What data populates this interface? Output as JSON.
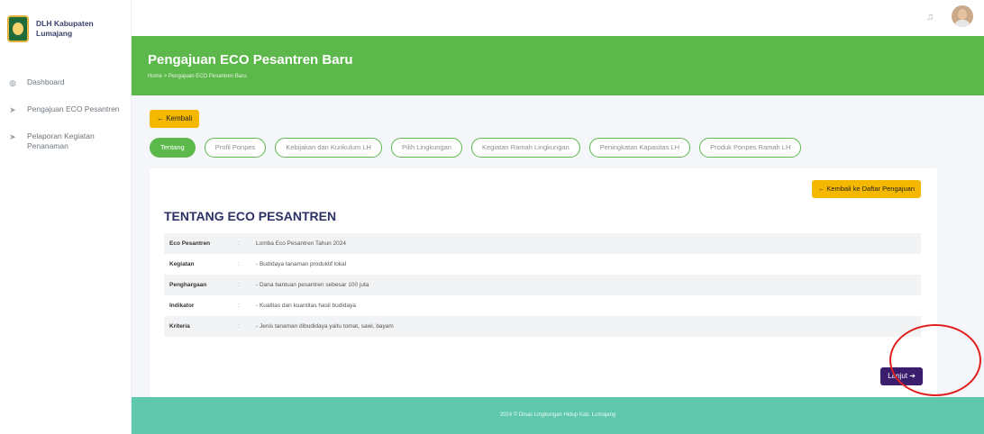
{
  "brand": {
    "line1": "DLH Kabupaten",
    "line2": "Lumajang"
  },
  "sidebar": {
    "items": [
      {
        "icon": "dashboard-icon",
        "label": "Dashboard"
      },
      {
        "icon": "send-icon",
        "label": "Pengajuan ECO Pesantren"
      },
      {
        "icon": "send-icon",
        "label": "Pelaporan Kegiatan Penanaman"
      }
    ]
  },
  "topbar": {
    "bell_icon": "bell-icon",
    "avatar": "user-avatar"
  },
  "banner": {
    "title": "Pengajuan ECO Pesantren Baru",
    "breadcrumb": "Home  >  Pengajuan ECO Pesantren Baru"
  },
  "back_button": "← Kembali",
  "tabs": [
    {
      "label": "Tentang",
      "active": true
    },
    {
      "label": "Profil Ponpes",
      "active": false
    },
    {
      "label": "Kebijakan dan Kurikulum LH",
      "active": false
    },
    {
      "label": "Pilih Lingkungan",
      "active": false
    },
    {
      "label": "Kegiatan Ramah Lingkungan",
      "active": false
    },
    {
      "label": "Peningkatan Kapasitas LH",
      "active": false
    },
    {
      "label": "Produk Ponpes Ramah LH",
      "active": false
    }
  ],
  "card": {
    "list_button": "← Kembali ke Daftar Pengajuan",
    "title": "TENTANG ECO PESANTREN",
    "rows": [
      {
        "label": "Eco Pesantren",
        "sep": ":",
        "value": "Lomba Eco Pesantren Tahun 2024"
      },
      {
        "label": "Kegiatan",
        "sep": ":",
        "value": "- Budidaya tanaman produktif lokal"
      },
      {
        "label": "Penghargaan",
        "sep": ":",
        "value": "- Dana bantuan pesantren sebesar 100 juta"
      },
      {
        "label": "Indikator",
        "sep": ":",
        "value": "- Kualitas dan kuantitas hasil budidaya"
      },
      {
        "label": "Kriteria",
        "sep": ":",
        "value": "- Jenis tanaman dibudidaya yaitu tomat, sawi, bayam"
      }
    ],
    "next_button": "Lanjut ➔"
  },
  "footer": {
    "text": "2024 © Dinas Lingkungan Hidup Kab. Lumajang"
  },
  "colors": {
    "primary_green": "#5cb84a",
    "footer_teal": "#5fc8ac",
    "accent_yellow": "#f5b800",
    "next_purple": "#3b1d6e",
    "annotation_red": "#e02020"
  }
}
